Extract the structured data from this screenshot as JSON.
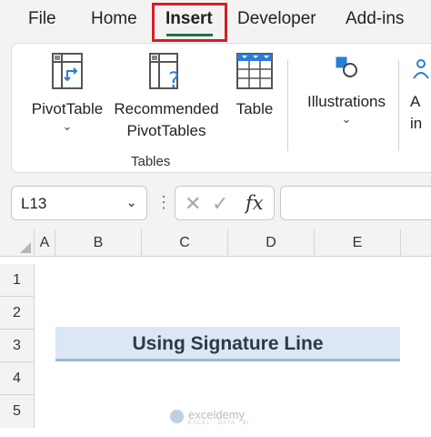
{
  "tabs": [
    {
      "label": "File"
    },
    {
      "label": "Home"
    },
    {
      "label": "Insert",
      "active": true
    },
    {
      "label": "Developer"
    },
    {
      "label": "Add-ins"
    }
  ],
  "ribbon": {
    "pivot_table": {
      "label": "PivotTable",
      "icon": "pivot-table-icon"
    },
    "recommended": {
      "label_line1": "Recommended",
      "label_line2": "PivotTables",
      "icon": "recommended-pivot-icon"
    },
    "table": {
      "label": "Table",
      "icon": "table-icon"
    },
    "group_label": "Tables",
    "illustrations": {
      "label": "Illustrations",
      "icon": "shapes-icon"
    },
    "addins_partial": {
      "line1": "A",
      "line2": "in"
    }
  },
  "formula_bar": {
    "name_box": "L13",
    "fx": "fx",
    "formula": ""
  },
  "grid": {
    "columns": [
      "A",
      "B",
      "C",
      "D",
      "E"
    ],
    "rows": [
      "1",
      "2",
      "3",
      "4",
      "5"
    ],
    "title_cell": "Using Signature Line"
  },
  "watermark": {
    "text": "exceldemy",
    "sub": "EXCEL · DATA · BI"
  },
  "colors": {
    "accent_green": "#217346",
    "highlight_red": "#d51f26",
    "title_fill": "#dbe7f4"
  }
}
